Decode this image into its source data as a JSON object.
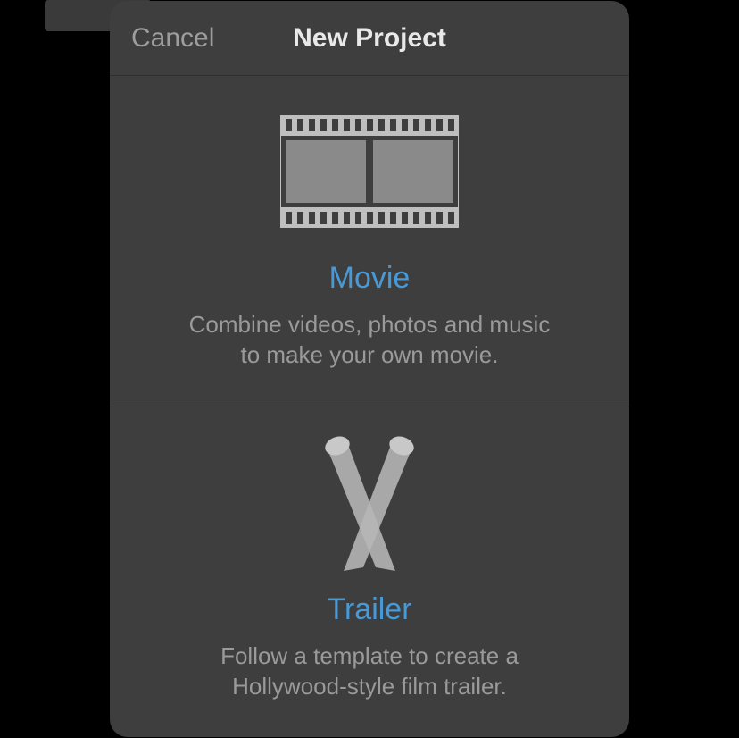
{
  "colors": {
    "background": "#000000",
    "modal_bg": "#3e3e3e",
    "divider": "#2f2f2f",
    "accent_link": "#479ad8",
    "muted_text": "#9a9a9a",
    "title_text": "#e9e9e9",
    "icon_light": "#bfbfbf",
    "icon_lighter": "#d9d9d9",
    "icon_fill": "#8a8a8a"
  },
  "header": {
    "cancel_label": "Cancel",
    "title": "New Project"
  },
  "options": [
    {
      "id": "movie",
      "title": "Movie",
      "description": "Combine videos, photos and music to make your own movie.",
      "icon_name": "filmstrip-icon"
    },
    {
      "id": "trailer",
      "title": "Trailer",
      "description": "Follow a template to create a Hollywood-style film trailer.",
      "icon_name": "spotlight-icon"
    }
  ]
}
